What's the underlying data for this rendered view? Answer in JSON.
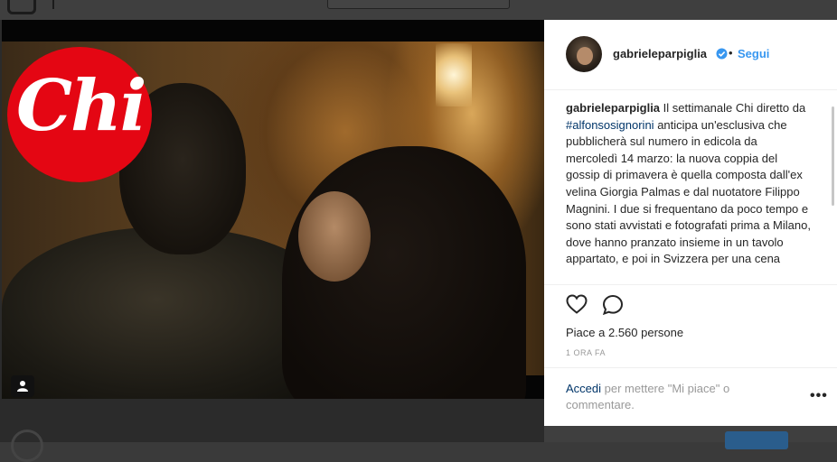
{
  "post": {
    "username": "gabrieleparpiglia",
    "dot": "•",
    "follow_label": "Segui",
    "caption_user": "gabrieleparpiglia",
    "caption_part1": " Il settimanale Chi diretto da ",
    "hashtag": "#alfonsosignorini",
    "caption_part2": " anticipa un'esclusiva che pubblicherà sul numero in edicola da mercoledì 14 marzo: la nuova coppia del gossip di primavera è quella composta dall'ex velina Giorgia Palmas e dal nuotatore Filippo Magnini. I due si frequentano da poco tempo e sono stati avvistati e fotografati prima a Milano, dove hanno pranzato insieme in un tavolo appartato, e poi in Svizzera per una cena",
    "likes": "Piace a 2.560 persone",
    "timestamp": "1 ORA FA",
    "login_link": "Accedi",
    "login_text": " per mettere \"Mi piace\" o commentare.",
    "more_label": "•••"
  },
  "photo": {
    "logo_text": "Chi"
  },
  "colors": {
    "accent": "#3897f0",
    "hashtag": "#003569",
    "chi_red": "#e40613"
  },
  "icons": {
    "verified": "verified-badge-icon",
    "heart": "heart-icon",
    "comment": "comment-icon",
    "user_tag": "user-tag-icon",
    "more": "more-options-icon"
  }
}
